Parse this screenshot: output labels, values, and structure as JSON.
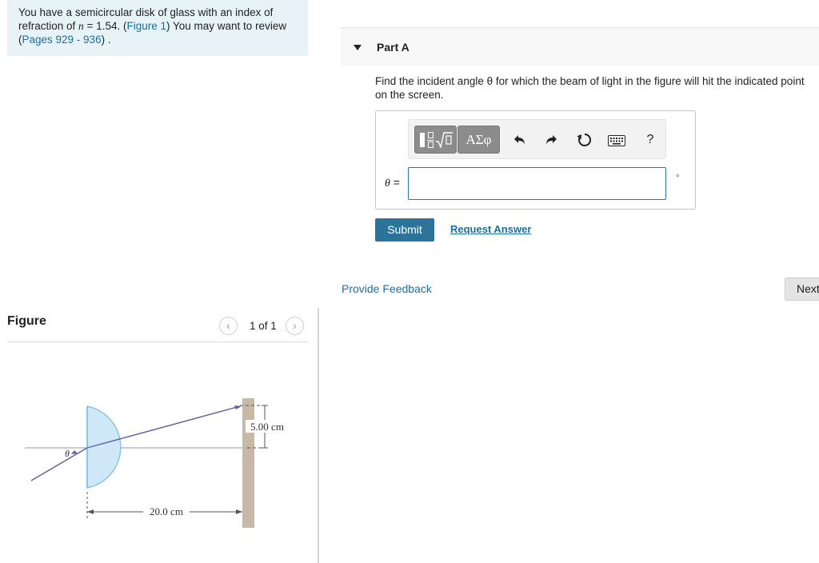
{
  "problem": {
    "text_before_n": "You have a semicircular disk of glass with an index of refraction of ",
    "n_symbol": "n",
    "text_after_n": " = 1.54. (",
    "figure_link": "Figure 1",
    "text_after_figure": ") You may want to review (",
    "pages_link": "Pages 929 - 936",
    "text_end": ") ."
  },
  "figure_panel": {
    "title": "Figure",
    "prev_icon": "chevron-left-icon",
    "next_icon": "chevron-right-icon",
    "page_count": "1 of 1",
    "labels": {
      "theta": "θ",
      "distance": "20.0 cm",
      "height": "5.00 cm"
    },
    "colors": {
      "glass_fill": "#cfe8f7",
      "glass_edge": "#7ab8de",
      "beam": "#5b5fa8",
      "screen": "#c8b8a6"
    }
  },
  "part_a": {
    "title": "Part A",
    "question": "Find the incident angle θ for which the beam of light in the figure will hit the indicated point on the screen.",
    "toolbar": {
      "greek_label": "ΑΣφ",
      "icons": [
        "fraction-root-template-icon",
        "undo-icon",
        "redo-icon",
        "reset-icon",
        "keyboard-icon",
        "help-icon"
      ],
      "help_label": "?"
    },
    "input": {
      "label": "θ =",
      "value": "",
      "unit": "°"
    },
    "submit_label": "Submit",
    "request_label": "Request Answer"
  },
  "footer": {
    "feedback_label": "Provide Feedback",
    "next_label": "Next"
  },
  "colors": {
    "link": "#1a6fa3",
    "submit_bg": "#2c7399",
    "problem_bg": "#e8f3f8",
    "input_border": "#2c6fa1"
  }
}
